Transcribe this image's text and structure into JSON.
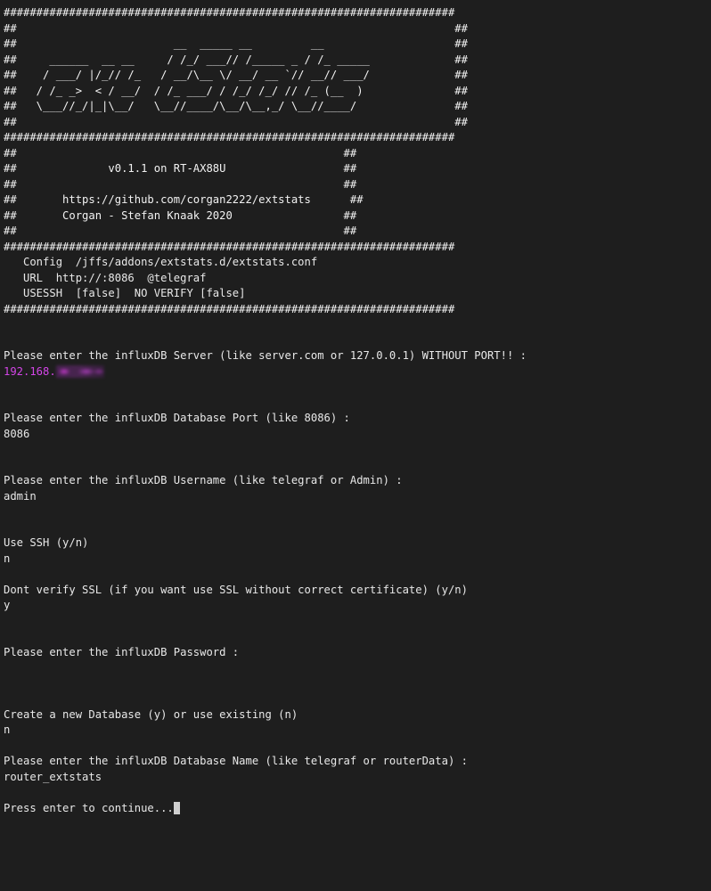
{
  "terminal": {
    "background_color": "#1e1e1e",
    "foreground_color": "#e8e8e8",
    "accent_color": "#d445e8",
    "cursor": "block-cursor"
  },
  "banner": {
    "border_top": "#####################################################################",
    "border_mid": "#####################################################################",
    "border_bottom": "#####################################################################",
    "ascii_logo": [
      "##                           __  _____ __         __                ##",
      "##        ______  __ __     / /_/ ___// /_____ _ / /_ _____         ##",
      "##       / ___/ |/_// /_   / __/\\__ \\/ __/ __ `// __// ___/         ##",
      "##      / /_ _>  < / __/  / /_ ___/ / /_/ /_/ // /_ (__  )          ##",
      "##      \\___//_/|_|\\__/   \\__//____/\\__/\\__,_/ \\__//____/           ##"
    ],
    "logo_lines": [
      "##                                                                   ##",
      "##                        __  _____ __         __                    ##",
      "##     ______  __ __     / /_/ ___// /_____ _ / /_ _____             ##",
      "##    / ___/ |/_// /_   / __/\\__ \\/ __/ __ `// __// ___/             ##",
      "##   / /_ _>  < / __/  / /_ ___/ / /_/ /_/ // /_ (__  )              ##",
      "##   \\___//_/|_|\\__/   \\__//____/\\__/\\__,_/ \\__//____/               ##",
      "##                                                                   ##"
    ],
    "version_line": "##              v0.1.1 on RT-AX88U                  ##",
    "empty_row": "##                                                  ##",
    "url_line": "##       https://github.com/corgan2222/extstats      ##",
    "author_line": "##       Corgan - Stefan Knaak 2020                 ##",
    "version": "v0.1.1",
    "device": "RT-AX88U",
    "project_url": "https://github.com/corgan2222/extstats",
    "author": "Corgan - Stefan Knaak 2020"
  },
  "config": {
    "config_line": "   Config  /jffs/addons/extstats.d/extstats.conf",
    "url_line": "   URL  http://:8086  @telegraf",
    "usessh_line": "   USESSH  [false]  NO VERIFY [false]",
    "config_path": "/jffs/addons/extstats.d/extstats.conf",
    "url": "http://:8086",
    "url_user": "@telegraf",
    "usessh": "[false]",
    "no_verify": "[false]"
  },
  "prompts": {
    "server_question": "Please enter the influxDB Server (like server.com or 127.0.0.1) WITHOUT PORT!! :",
    "server_answer_visible": "192.168.",
    "server_answer_redacted": true,
    "port_question": "Please enter the influxDB Database Port (like 8086) :",
    "port_answer": "8086",
    "username_question": "Please enter the influxDB Username (like telegraf or Admin) :",
    "username_answer": "admin",
    "ssh_question": "Use SSH (y/n)",
    "ssh_answer": "n",
    "ssl_question": "Dont verify SSL (if you want use SSL without correct certificate) (y/n)",
    "ssl_answer": "y",
    "password_question": "Please enter the influxDB Password :",
    "password_answer": "",
    "createdb_question": "Create a new Database (y) or use existing (n)",
    "createdb_answer": "n",
    "dbname_question": "Please enter the influxDB Database Name (like telegraf or routerData) :",
    "dbname_answer": "router_extstats",
    "continue_prompt": "Press enter to continue..."
  }
}
